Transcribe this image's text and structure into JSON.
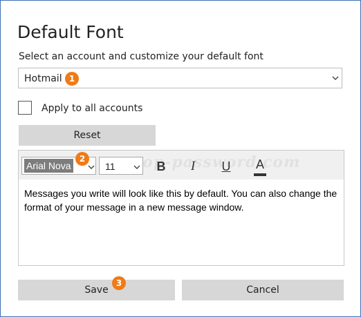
{
  "dialog": {
    "title": "Default Font",
    "subtitle": "Select an account and customize your default font"
  },
  "account": {
    "selected": "Hotmail"
  },
  "apply_all": {
    "label": "Apply to all accounts",
    "checked": false
  },
  "reset": {
    "label": "Reset"
  },
  "toolbar": {
    "font_name": "Arial Nova",
    "font_size": "11",
    "bold_label": "B",
    "italic_label": "I",
    "underline_label": "U",
    "font_color_label": "A"
  },
  "preview": {
    "text": "Messages you write will look like this by default. You can also change the format of your message in a new message window."
  },
  "watermark": "top-password.com",
  "badges": [
    "1",
    "2",
    "3"
  ],
  "actions": {
    "save_label": "Save",
    "cancel_label": "Cancel"
  },
  "colors": {
    "badge": "#f07b16",
    "button_bg": "#d7d7d7",
    "window_border": "#3d6fb4"
  }
}
